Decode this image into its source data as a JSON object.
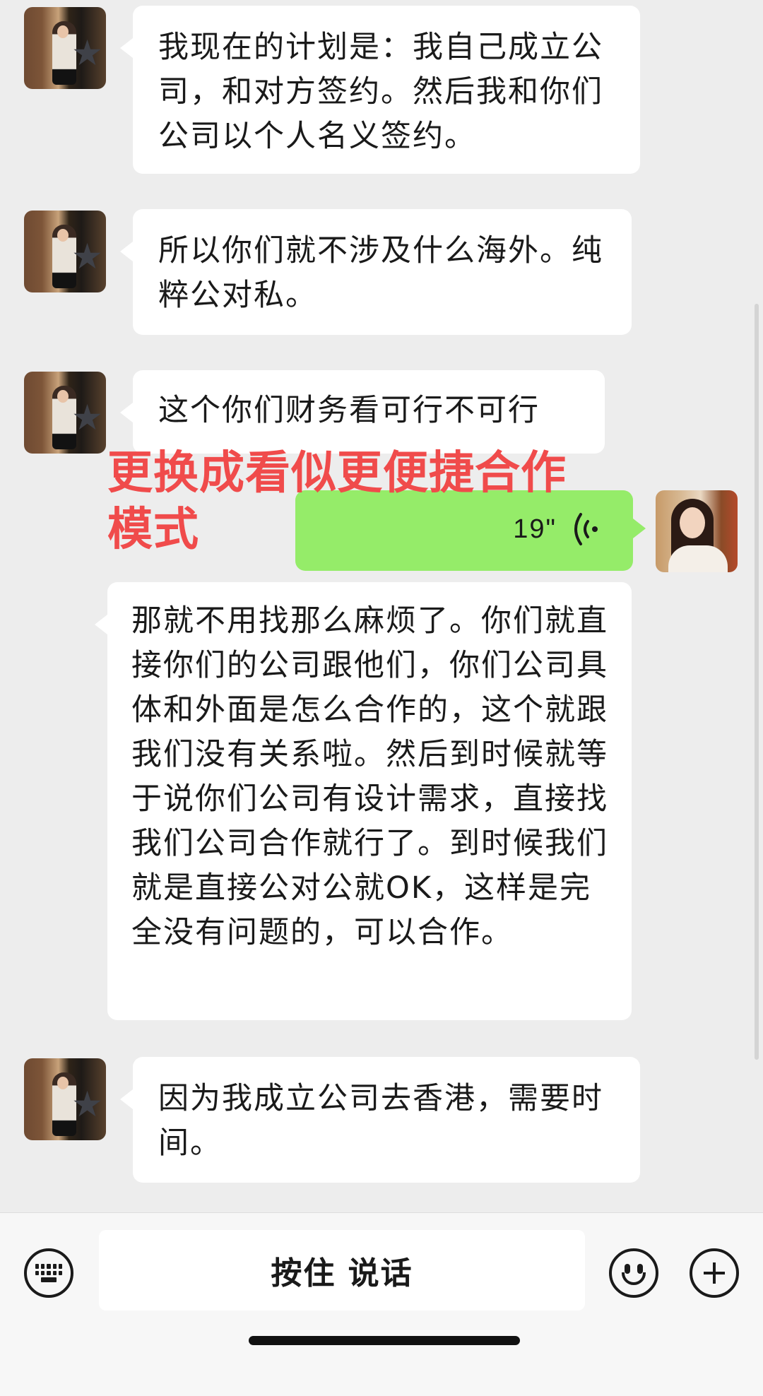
{
  "messages": [
    {
      "from": "other",
      "text": "我现在的计划是：我自己成立公司，和对方签约。然后我和你们公司以个人名义签约。"
    },
    {
      "from": "other",
      "text": "所以你们就不涉及什么海外。纯粹公对私。"
    },
    {
      "from": "other",
      "text": "这个你们财务看可行不可行"
    },
    {
      "from": "self",
      "type": "voice",
      "duration": "19\""
    },
    {
      "from": "other",
      "text": "那就不用找那么麻烦了。你们就直接你们的公司跟他们，你们公司具体和外面是怎么合作的，这个就跟我们没有关系啦。然后到时候就等于说你们公司有设计需求，直接找我们公司合作就行了。到时候我们就是直接公对公就OK，这样是完全没有问题的，可以合作。"
    },
    {
      "from": "other",
      "text": "因为我成立公司去香港，需要时间。"
    }
  ],
  "annotation": "更换成看似更便捷合作模式",
  "input_bar": {
    "hold_to_talk": "按住 说话",
    "left_icon": "keyboard-icon",
    "emoji_icon": "emoji-icon",
    "plus_icon": "plus-icon"
  },
  "colors": {
    "background": "#ededed",
    "bubble_other": "#ffffff",
    "bubble_self": "#95ec69",
    "annotation": "#f04b4b"
  }
}
